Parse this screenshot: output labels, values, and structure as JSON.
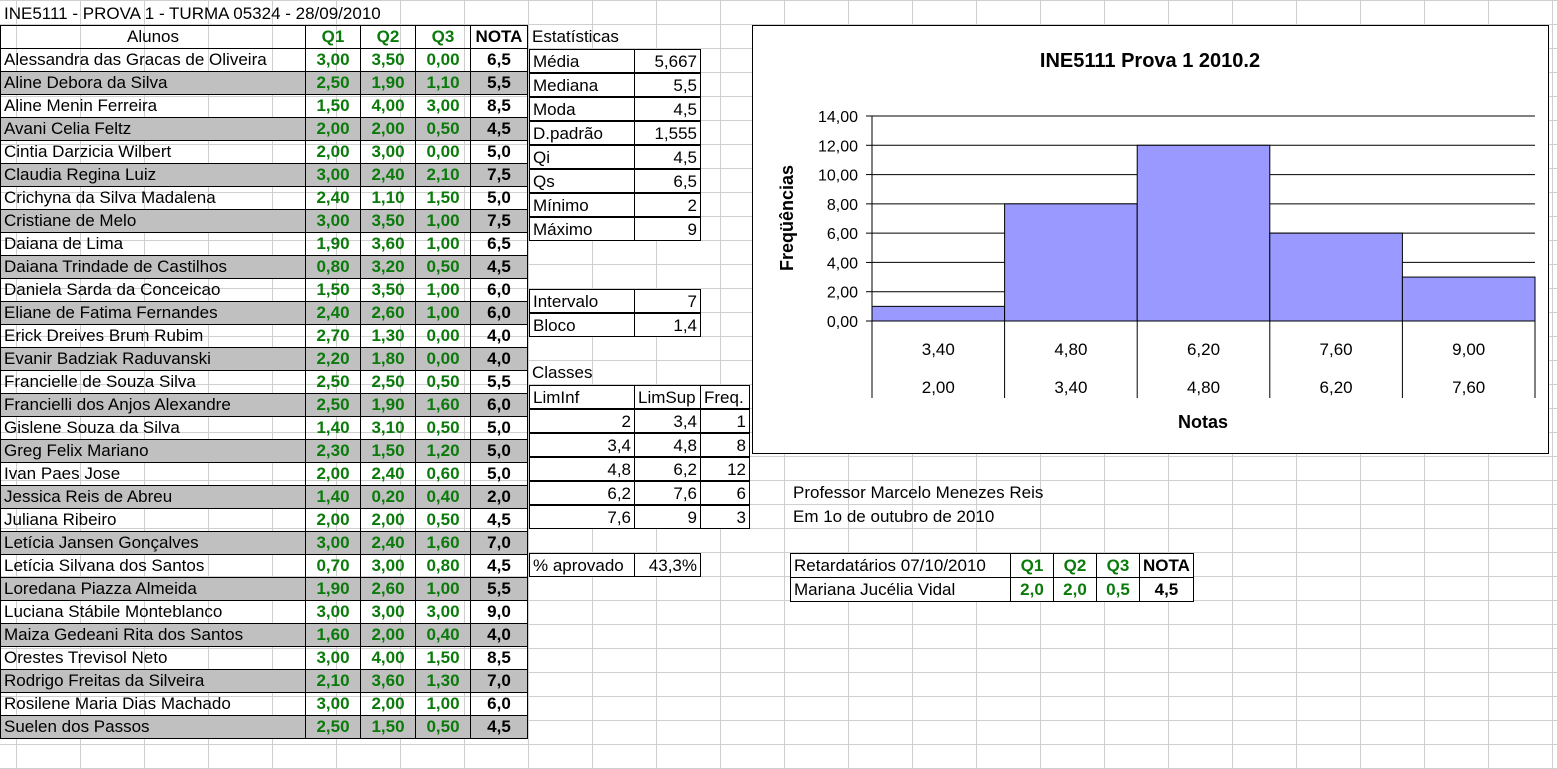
{
  "sheet_title": "INE5111 - PROVA 1 - TURMA 05324 - 28/09/2010",
  "headers": {
    "alunos": "Alunos",
    "q1": "Q1",
    "q2": "Q2",
    "q3": "Q3",
    "nota": "NOTA",
    "estatisticas": "Estatísticas"
  },
  "students": [
    {
      "name": "Alessandra das Gracas de Oliveira",
      "q1": "3,00",
      "q2": "3,50",
      "q3": "0,00",
      "nota": "6,5"
    },
    {
      "name": "Aline Debora da Silva",
      "q1": "2,50",
      "q2": "1,90",
      "q3": "1,10",
      "nota": "5,5"
    },
    {
      "name": "Aline Menin Ferreira",
      "q1": "1,50",
      "q2": "4,00",
      "q3": "3,00",
      "nota": "8,5"
    },
    {
      "name": "Avani Celia Feltz",
      "q1": "2,00",
      "q2": "2,00",
      "q3": "0,50",
      "nota": "4,5"
    },
    {
      "name": "Cintia Darzicia Wilbert",
      "q1": "2,00",
      "q2": "3,00",
      "q3": "0,00",
      "nota": "5,0"
    },
    {
      "name": "Claudia Regina Luiz",
      "q1": "3,00",
      "q2": "2,40",
      "q3": "2,10",
      "nota": "7,5"
    },
    {
      "name": "Crichyna da Silva Madalena",
      "q1": "2,40",
      "q2": "1,10",
      "q3": "1,50",
      "nota": "5,0"
    },
    {
      "name": "Cristiane de Melo",
      "q1": "3,00",
      "q2": "3,50",
      "q3": "1,00",
      "nota": "7,5"
    },
    {
      "name": "Daiana de Lima",
      "q1": "1,90",
      "q2": "3,60",
      "q3": "1,00",
      "nota": "6,5"
    },
    {
      "name": "Daiana Trindade de Castilhos",
      "q1": "0,80",
      "q2": "3,20",
      "q3": "0,50",
      "nota": "4,5"
    },
    {
      "name": "Daniela Sarda da Conceicao",
      "q1": "1,50",
      "q2": "3,50",
      "q3": "1,00",
      "nota": "6,0"
    },
    {
      "name": "Eliane de Fatima Fernandes",
      "q1": "2,40",
      "q2": "2,60",
      "q3": "1,00",
      "nota": "6,0"
    },
    {
      "name": "Erick Dreives Brum Rubim",
      "q1": "2,70",
      "q2": "1,30",
      "q3": "0,00",
      "nota": "4,0"
    },
    {
      "name": "Evanir Badziak Raduvanski",
      "q1": "2,20",
      "q2": "1,80",
      "q3": "0,00",
      "nota": "4,0"
    },
    {
      "name": "Francielle de Souza Silva",
      "q1": "2,50",
      "q2": "2,50",
      "q3": "0,50",
      "nota": "5,5"
    },
    {
      "name": "Francielli dos Anjos Alexandre",
      "q1": "2,50",
      "q2": "1,90",
      "q3": "1,60",
      "nota": "6,0"
    },
    {
      "name": "Gislene Souza da Silva",
      "q1": "1,40",
      "q2": "3,10",
      "q3": "0,50",
      "nota": "5,0"
    },
    {
      "name": "Greg Felix Mariano",
      "q1": "2,30",
      "q2": "1,50",
      "q3": "1,20",
      "nota": "5,0"
    },
    {
      "name": "Ivan Paes Jose",
      "q1": "2,00",
      "q2": "2,40",
      "q3": "0,60",
      "nota": "5,0"
    },
    {
      "name": "Jessica Reis de Abreu",
      "q1": "1,40",
      "q2": "0,20",
      "q3": "0,40",
      "nota": "2,0"
    },
    {
      "name": "Juliana Ribeiro",
      "q1": "2,00",
      "q2": "2,00",
      "q3": "0,50",
      "nota": "4,5"
    },
    {
      "name": "Letícia Jansen Gonçalves",
      "q1": "3,00",
      "q2": "2,40",
      "q3": "1,60",
      "nota": "7,0"
    },
    {
      "name": "Letícia Silvana dos Santos",
      "q1": "0,70",
      "q2": "3,00",
      "q3": "0,80",
      "nota": "4,5"
    },
    {
      "name": "Loredana Piazza Almeida",
      "q1": "1,90",
      "q2": "2,60",
      "q3": "1,00",
      "nota": "5,5"
    },
    {
      "name": "Luciana Stábile Monteblanco",
      "q1": "3,00",
      "q2": "3,00",
      "q3": "3,00",
      "nota": "9,0"
    },
    {
      "name": "Maiza Gedeani Rita dos Santos",
      "q1": "1,60",
      "q2": "2,00",
      "q3": "0,40",
      "nota": "4,0"
    },
    {
      "name": "Orestes Trevisol Neto",
      "q1": "3,00",
      "q2": "4,00",
      "q3": "1,50",
      "nota": "8,5"
    },
    {
      "name": "Rodrigo Freitas da Silveira",
      "q1": "2,10",
      "q2": "3,60",
      "q3": "1,30",
      "nota": "7,0"
    },
    {
      "name": "Rosilene Maria Dias Machado",
      "q1": "3,00",
      "q2": "2,00",
      "q3": "1,00",
      "nota": "6,0"
    },
    {
      "name": "Suelen dos Passos",
      "q1": "2,50",
      "q2": "1,50",
      "q3": "0,50",
      "nota": "4,5"
    }
  ],
  "stats": [
    {
      "label": "Média",
      "value": "5,667"
    },
    {
      "label": "Mediana",
      "value": "5,5"
    },
    {
      "label": "Moda",
      "value": "4,5"
    },
    {
      "label": "D.padrão",
      "value": "1,555"
    },
    {
      "label": "Qi",
      "value": "4,5"
    },
    {
      "label": "Qs",
      "value": "6,5"
    },
    {
      "label": "Mínimo",
      "value": "2"
    },
    {
      "label": "Máximo",
      "value": "9"
    }
  ],
  "intervalo": {
    "label": "Intervalo",
    "value": "7"
  },
  "bloco": {
    "label": "Bloco",
    "value": "1,4"
  },
  "classes": {
    "label": "Classes",
    "headers": {
      "liminf": "LimInf",
      "limsup": "LimSup",
      "freq": "Freq."
    },
    "rows": [
      {
        "liminf": "2",
        "limsup": "3,4",
        "freq": "1"
      },
      {
        "liminf": "3,4",
        "limsup": "4,8",
        "freq": "8"
      },
      {
        "liminf": "4,8",
        "limsup": "6,2",
        "freq": "12"
      },
      {
        "liminf": "6,2",
        "limsup": "7,6",
        "freq": "6"
      },
      {
        "liminf": "7,6",
        "limsup": "9",
        "freq": "3"
      }
    ]
  },
  "aprovado": {
    "label": "% aprovado",
    "value": "43,3%"
  },
  "professor": "Professor Marcelo Menezes Reis",
  "date_note": "Em 1o de outubro de 2010",
  "late": {
    "header": {
      "label": "Retardatários 07/10/2010",
      "q1": "Q1",
      "q2": "Q2",
      "q3": "Q3",
      "nota": "NOTA"
    },
    "row": {
      "name": "Mariana Jucélia Vidal",
      "q1": "2,0",
      "q2": "2,0",
      "q3": "0,5",
      "nota": "4,5"
    }
  },
  "colors": {
    "shade": "#c0c0c0",
    "green": "#0a7a0a",
    "bar": "#9999ff",
    "grid": "#cfcfcf"
  },
  "chart_data": {
    "type": "bar",
    "title": "INE5111 Prova 1 2010.2",
    "xlabel": "Notas",
    "ylabel": "Freqüências",
    "categories_upper": [
      "3,40",
      "4,80",
      "6,20",
      "7,60",
      "9,00"
    ],
    "categories_lower": [
      "2,00",
      "3,40",
      "4,80",
      "6,20",
      "7,60"
    ],
    "values": [
      1,
      8,
      12,
      6,
      3
    ],
    "ylim": [
      0,
      14
    ],
    "yticks": [
      "0,00",
      "2,00",
      "4,00",
      "6,00",
      "8,00",
      "10,00",
      "12,00",
      "14,00"
    ],
    "grid": true,
    "legend": "none"
  }
}
